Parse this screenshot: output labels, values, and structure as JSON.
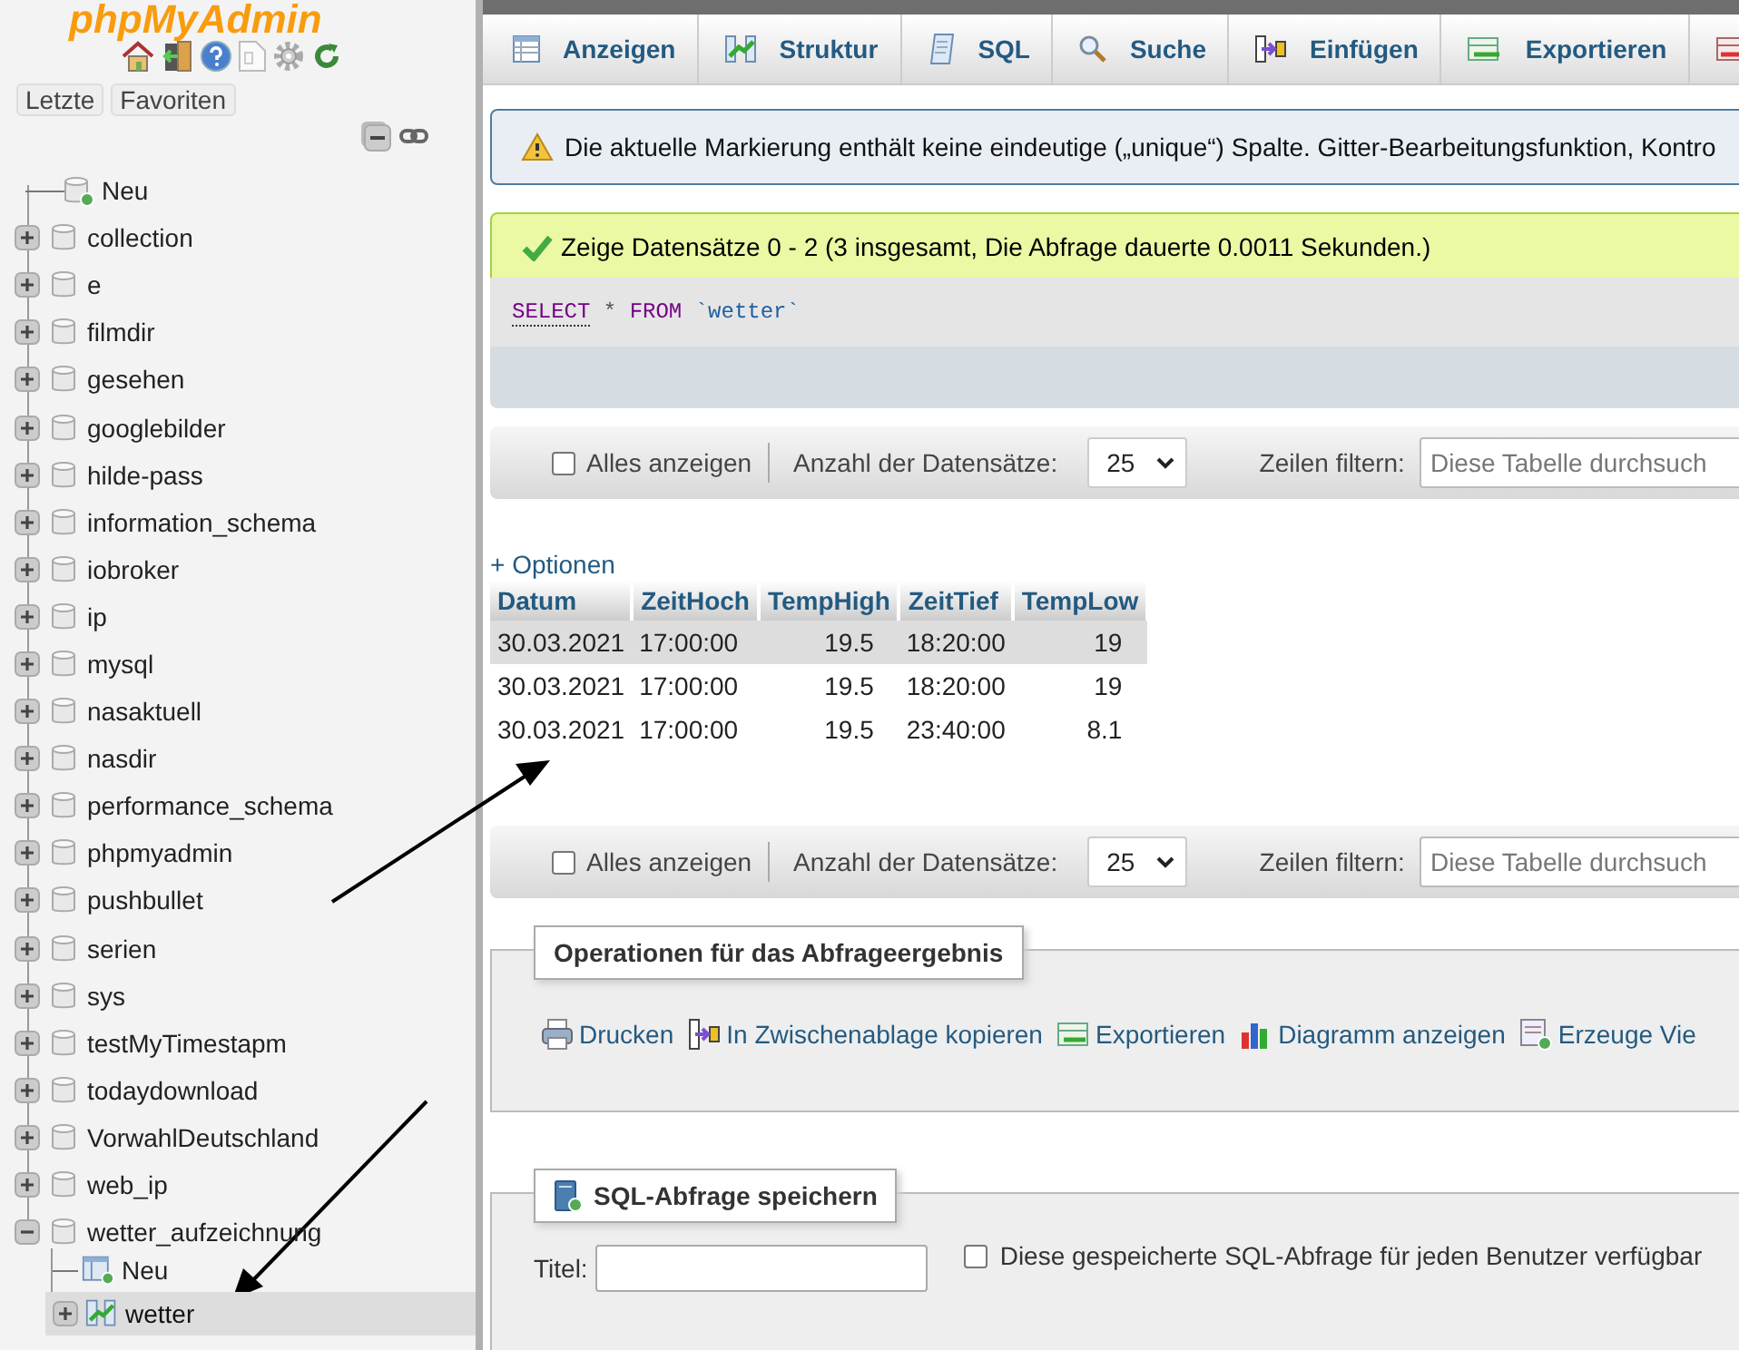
{
  "logo": "phpMyAdmin",
  "sidebar": {
    "buttons": [
      {
        "label": "Letzte"
      },
      {
        "label": "Favoriten"
      }
    ],
    "tree": [
      {
        "label": "Neu",
        "kind": "new",
        "selected": false
      },
      {
        "label": "collection",
        "kind": "database",
        "expanded": false,
        "selected": false
      },
      {
        "label": "e",
        "kind": "database",
        "expanded": false,
        "selected": false
      },
      {
        "label": "filmdir",
        "kind": "database",
        "expanded": false,
        "selected": false
      },
      {
        "label": "gesehen",
        "kind": "database",
        "expanded": false,
        "selected": false
      },
      {
        "label": "googlebilder",
        "kind": "database",
        "expanded": false,
        "selected": false
      },
      {
        "label": "hilde-pass",
        "kind": "database",
        "expanded": false,
        "selected": false
      },
      {
        "label": "information_schema",
        "kind": "database",
        "expanded": false,
        "selected": false
      },
      {
        "label": "iobroker",
        "kind": "database",
        "expanded": false,
        "selected": false
      },
      {
        "label": "ip",
        "kind": "database",
        "expanded": false,
        "selected": false
      },
      {
        "label": "mysql",
        "kind": "database",
        "expanded": false,
        "selected": false
      },
      {
        "label": "nasaktuell",
        "kind": "database",
        "expanded": false,
        "selected": false
      },
      {
        "label": "nasdir",
        "kind": "database",
        "expanded": false,
        "selected": false
      },
      {
        "label": "performance_schema",
        "kind": "database",
        "expanded": false,
        "selected": false
      },
      {
        "label": "phpmyadmin",
        "kind": "database",
        "expanded": false,
        "selected": false
      },
      {
        "label": "pushbullet",
        "kind": "database",
        "expanded": false,
        "selected": false
      },
      {
        "label": "serien",
        "kind": "database",
        "expanded": false,
        "selected": false
      },
      {
        "label": "sys",
        "kind": "database",
        "expanded": false,
        "selected": false
      },
      {
        "label": "testMyTimestapm",
        "kind": "database",
        "expanded": false,
        "selected": false
      },
      {
        "label": "todaydownload",
        "kind": "database",
        "expanded": false,
        "selected": false
      },
      {
        "label": "VorwahlDeutschland",
        "kind": "database",
        "expanded": false,
        "selected": false
      },
      {
        "label": "web_ip",
        "kind": "database",
        "expanded": false,
        "selected": false
      },
      {
        "label": "wetter_aufzeichnung",
        "kind": "database",
        "expanded": true,
        "selected": false,
        "children": [
          {
            "label": "Neu",
            "kind": "new-table",
            "selected": false
          },
          {
            "label": "wetter",
            "kind": "table",
            "expanded": false,
            "selected": true
          }
        ]
      }
    ]
  },
  "tabs": [
    {
      "label": "Anzeigen",
      "selected": false
    },
    {
      "label": "Struktur",
      "selected": false
    },
    {
      "label": "SQL",
      "selected": false
    },
    {
      "label": "Suche",
      "selected": false
    },
    {
      "label": "Einfügen",
      "selected": false
    },
    {
      "label": "Exportieren",
      "selected": false
    }
  ],
  "notice": "Die aktuelle Markierung enthält keine eindeutige („unique“) Spalte. Gitter-Bearbeitungsfunktion, Kontro",
  "success": "Zeige Datensätze 0 - 2 (3 insgesamt, Die Abfrage dauerte 0.0011 Sekunden.)",
  "sql_query": [
    {
      "text": "SELECT",
      "kind": "keyword"
    },
    {
      "text": "*",
      "kind": "operator"
    },
    {
      "text": "FROM",
      "kind": "keyword"
    },
    {
      "text": "`wetter`",
      "kind": "identifier"
    }
  ],
  "navigation_bars": [
    {
      "show_all": "Alles anzeigen",
      "show_all_checked": false,
      "count_label": "Anzahl der Datensätze:",
      "count_value": "25",
      "filter_label": "Zeilen filtern:",
      "filter_placeholder": "Diese Tabelle durchsuch"
    },
    {
      "show_all": "Alles anzeigen",
      "show_all_checked": false,
      "count_label": "Anzahl der Datensätze:",
      "count_value": "25",
      "filter_label": "Zeilen filtern:",
      "filter_placeholder": "Diese Tabelle durchsuch"
    }
  ],
  "options_link": "+ Optionen",
  "table": {
    "columns": [
      "Datum",
      "ZeitHoch",
      "TempHigh",
      "ZeitTief",
      "TempLow"
    ],
    "rows": [
      [
        "30.03.2021",
        "17:00:00",
        "19.5",
        "18:20:00",
        "19"
      ],
      [
        "30.03.2021",
        "17:00:00",
        "19.5",
        "18:20:00",
        "19"
      ],
      [
        "30.03.2021",
        "17:00:00",
        "19.5",
        "23:40:00",
        "8.1"
      ]
    ]
  },
  "operations": {
    "title": "Operationen für das Abfrageergebnis",
    "links": [
      "Drucken",
      "In Zwischenablage kopieren",
      "Exportieren",
      "Diagramm anzeigen",
      "Erzeuge Vie"
    ]
  },
  "save_query": {
    "title": "SQL-Abfrage speichern",
    "title_label": "Titel:",
    "share_label": "Diese gespeicherte SQL-Abfrage für jeden Benutzer verfügbar",
    "share_checked": false
  }
}
